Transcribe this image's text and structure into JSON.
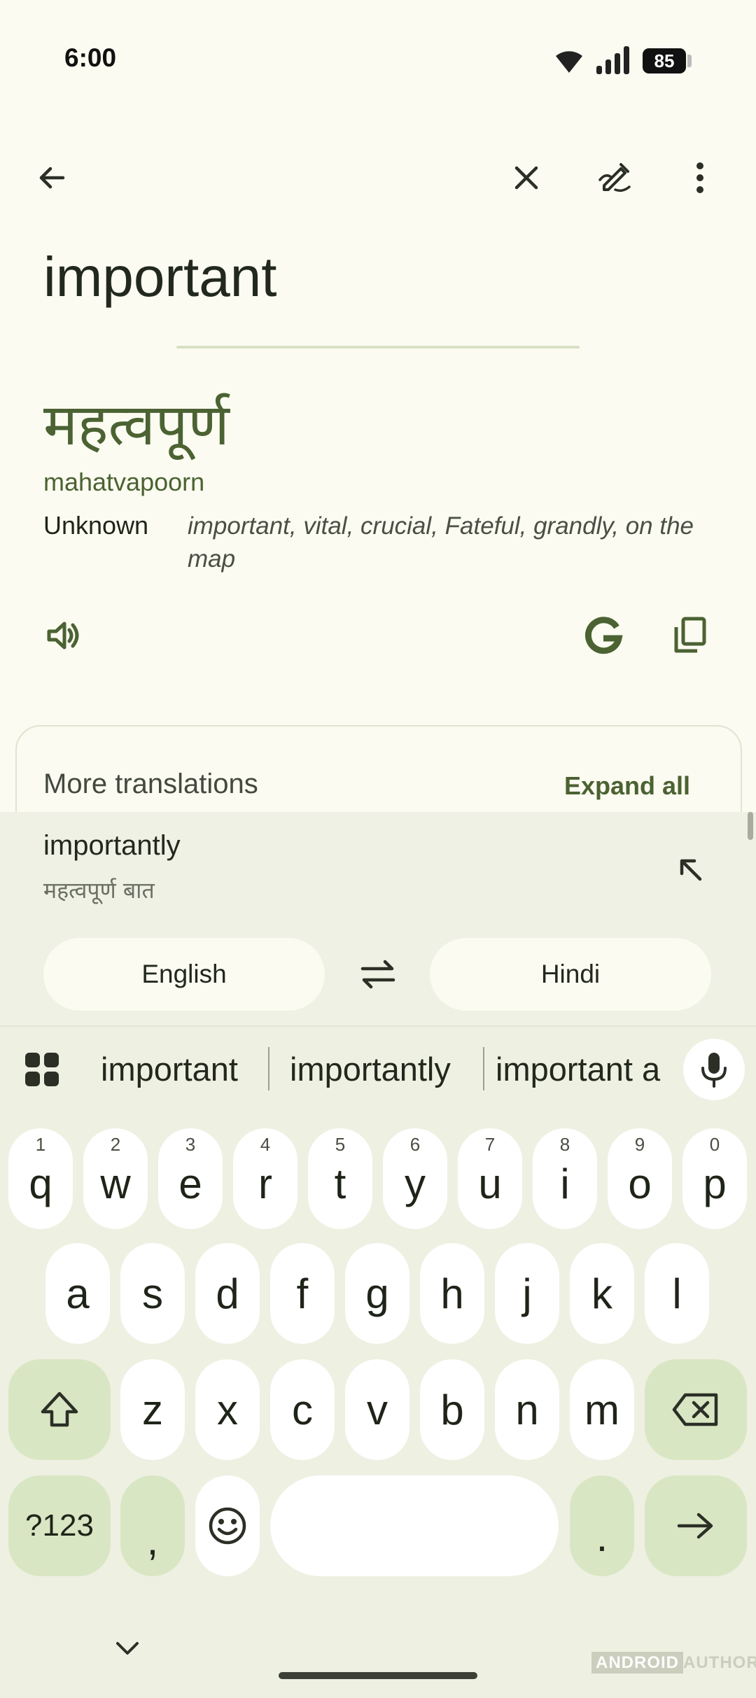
{
  "status_bar": {
    "time": "6:00",
    "battery": "85"
  },
  "toolbar": {
    "back": "arrow-left-icon",
    "clear": "close-icon",
    "handwriting": "handwriting-pen-icon",
    "more": "more-vert-icon"
  },
  "source": {
    "text": "important"
  },
  "result": {
    "translation": "महत्वपूर्ण",
    "transliteration": "mahatvapoorn",
    "part_of_speech": "Unknown",
    "synonyms": "important, vital, crucial, Fateful, grandly, on the map",
    "actions": [
      "speaker-icon",
      "google-icon",
      "copy-icon"
    ]
  },
  "more_translations": {
    "title": "More translations",
    "expand_label": "Expand all"
  },
  "suggestion": {
    "word": "importantly",
    "translation": "महत्वपूर्ण बात",
    "icon": "arrow-up-left-icon"
  },
  "languages": {
    "source": "English",
    "target": "Hindi",
    "swap_icon": "swap-icon"
  },
  "keyboard": {
    "suggestions": [
      "important",
      "importantly",
      "important a"
    ],
    "row1": [
      {
        "hint": "1",
        "key": "q"
      },
      {
        "hint": "2",
        "key": "w"
      },
      {
        "hint": "3",
        "key": "e"
      },
      {
        "hint": "4",
        "key": "r"
      },
      {
        "hint": "5",
        "key": "t"
      },
      {
        "hint": "6",
        "key": "y"
      },
      {
        "hint": "7",
        "key": "u"
      },
      {
        "hint": "8",
        "key": "i"
      },
      {
        "hint": "9",
        "key": "o"
      },
      {
        "hint": "0",
        "key": "p"
      }
    ],
    "row2": [
      "a",
      "s",
      "d",
      "f",
      "g",
      "h",
      "j",
      "k",
      "l"
    ],
    "row3": [
      "z",
      "x",
      "c",
      "v",
      "b",
      "n",
      "m"
    ],
    "symbols_label": "?123",
    "comma": ",",
    "period": "."
  },
  "watermark": {
    "box": "ANDROID",
    "rest": "AUTHORITY"
  },
  "colors": {
    "accent": "#4b6232",
    "background": "#fbfbf1",
    "keyboard_bg": "#eef0e2",
    "key_green": "#d9e6c3"
  }
}
